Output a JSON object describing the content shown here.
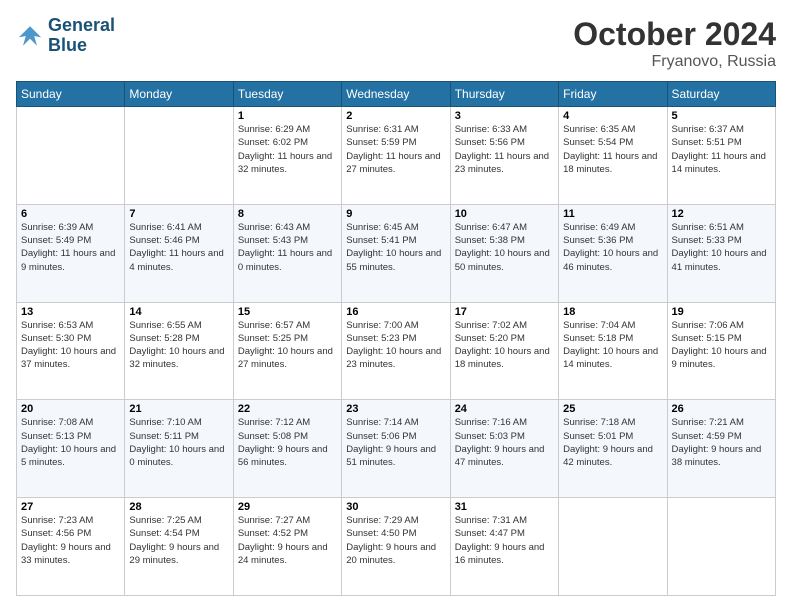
{
  "logo": {
    "line1": "General",
    "line2": "Blue"
  },
  "header": {
    "month": "October 2024",
    "location": "Fryanovo, Russia"
  },
  "weekdays": [
    "Sunday",
    "Monday",
    "Tuesday",
    "Wednesday",
    "Thursday",
    "Friday",
    "Saturday"
  ],
  "weeks": [
    [
      {
        "day": "",
        "info": ""
      },
      {
        "day": "",
        "info": ""
      },
      {
        "day": "1",
        "info": "Sunrise: 6:29 AM\nSunset: 6:02 PM\nDaylight: 11 hours and 32 minutes."
      },
      {
        "day": "2",
        "info": "Sunrise: 6:31 AM\nSunset: 5:59 PM\nDaylight: 11 hours and 27 minutes."
      },
      {
        "day": "3",
        "info": "Sunrise: 6:33 AM\nSunset: 5:56 PM\nDaylight: 11 hours and 23 minutes."
      },
      {
        "day": "4",
        "info": "Sunrise: 6:35 AM\nSunset: 5:54 PM\nDaylight: 11 hours and 18 minutes."
      },
      {
        "day": "5",
        "info": "Sunrise: 6:37 AM\nSunset: 5:51 PM\nDaylight: 11 hours and 14 minutes."
      }
    ],
    [
      {
        "day": "6",
        "info": "Sunrise: 6:39 AM\nSunset: 5:49 PM\nDaylight: 11 hours and 9 minutes."
      },
      {
        "day": "7",
        "info": "Sunrise: 6:41 AM\nSunset: 5:46 PM\nDaylight: 11 hours and 4 minutes."
      },
      {
        "day": "8",
        "info": "Sunrise: 6:43 AM\nSunset: 5:43 PM\nDaylight: 11 hours and 0 minutes."
      },
      {
        "day": "9",
        "info": "Sunrise: 6:45 AM\nSunset: 5:41 PM\nDaylight: 10 hours and 55 minutes."
      },
      {
        "day": "10",
        "info": "Sunrise: 6:47 AM\nSunset: 5:38 PM\nDaylight: 10 hours and 50 minutes."
      },
      {
        "day": "11",
        "info": "Sunrise: 6:49 AM\nSunset: 5:36 PM\nDaylight: 10 hours and 46 minutes."
      },
      {
        "day": "12",
        "info": "Sunrise: 6:51 AM\nSunset: 5:33 PM\nDaylight: 10 hours and 41 minutes."
      }
    ],
    [
      {
        "day": "13",
        "info": "Sunrise: 6:53 AM\nSunset: 5:30 PM\nDaylight: 10 hours and 37 minutes."
      },
      {
        "day": "14",
        "info": "Sunrise: 6:55 AM\nSunset: 5:28 PM\nDaylight: 10 hours and 32 minutes."
      },
      {
        "day": "15",
        "info": "Sunrise: 6:57 AM\nSunset: 5:25 PM\nDaylight: 10 hours and 27 minutes."
      },
      {
        "day": "16",
        "info": "Sunrise: 7:00 AM\nSunset: 5:23 PM\nDaylight: 10 hours and 23 minutes."
      },
      {
        "day": "17",
        "info": "Sunrise: 7:02 AM\nSunset: 5:20 PM\nDaylight: 10 hours and 18 minutes."
      },
      {
        "day": "18",
        "info": "Sunrise: 7:04 AM\nSunset: 5:18 PM\nDaylight: 10 hours and 14 minutes."
      },
      {
        "day": "19",
        "info": "Sunrise: 7:06 AM\nSunset: 5:15 PM\nDaylight: 10 hours and 9 minutes."
      }
    ],
    [
      {
        "day": "20",
        "info": "Sunrise: 7:08 AM\nSunset: 5:13 PM\nDaylight: 10 hours and 5 minutes."
      },
      {
        "day": "21",
        "info": "Sunrise: 7:10 AM\nSunset: 5:11 PM\nDaylight: 10 hours and 0 minutes."
      },
      {
        "day": "22",
        "info": "Sunrise: 7:12 AM\nSunset: 5:08 PM\nDaylight: 9 hours and 56 minutes."
      },
      {
        "day": "23",
        "info": "Sunrise: 7:14 AM\nSunset: 5:06 PM\nDaylight: 9 hours and 51 minutes."
      },
      {
        "day": "24",
        "info": "Sunrise: 7:16 AM\nSunset: 5:03 PM\nDaylight: 9 hours and 47 minutes."
      },
      {
        "day": "25",
        "info": "Sunrise: 7:18 AM\nSunset: 5:01 PM\nDaylight: 9 hours and 42 minutes."
      },
      {
        "day": "26",
        "info": "Sunrise: 7:21 AM\nSunset: 4:59 PM\nDaylight: 9 hours and 38 minutes."
      }
    ],
    [
      {
        "day": "27",
        "info": "Sunrise: 7:23 AM\nSunset: 4:56 PM\nDaylight: 9 hours and 33 minutes."
      },
      {
        "day": "28",
        "info": "Sunrise: 7:25 AM\nSunset: 4:54 PM\nDaylight: 9 hours and 29 minutes."
      },
      {
        "day": "29",
        "info": "Sunrise: 7:27 AM\nSunset: 4:52 PM\nDaylight: 9 hours and 24 minutes."
      },
      {
        "day": "30",
        "info": "Sunrise: 7:29 AM\nSunset: 4:50 PM\nDaylight: 9 hours and 20 minutes."
      },
      {
        "day": "31",
        "info": "Sunrise: 7:31 AM\nSunset: 4:47 PM\nDaylight: 9 hours and 16 minutes."
      },
      {
        "day": "",
        "info": ""
      },
      {
        "day": "",
        "info": ""
      }
    ]
  ]
}
